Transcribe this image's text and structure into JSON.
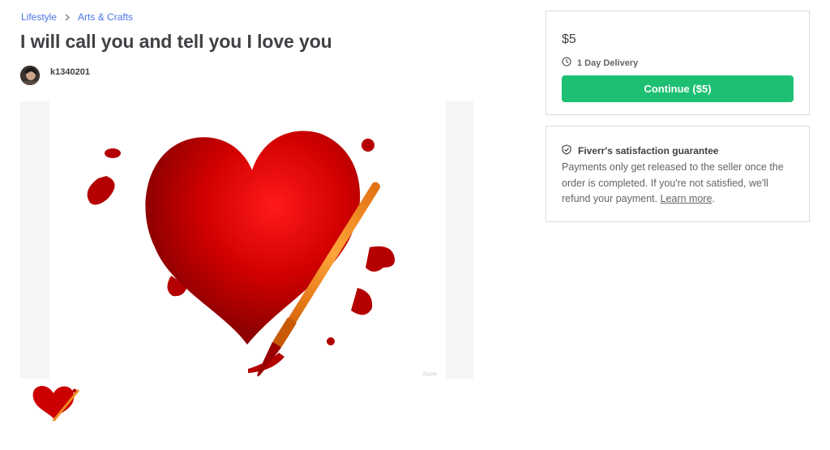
{
  "breadcrumb": {
    "items": [
      "Lifestyle",
      "Arts & Crafts"
    ]
  },
  "gig": {
    "title": "I will call you and tell you I love you",
    "seller": "k1340201",
    "watermark": "Zazzle"
  },
  "pricing": {
    "price": "$5",
    "delivery": "1 Day Delivery",
    "continue_label": "Continue ($5)"
  },
  "guarantee": {
    "title": "Fiverr's satisfaction guarantee",
    "body": "Payments only get released to the seller once the order is completed. If you're not satisfied, we'll refund your payment.",
    "link": "Learn more",
    "period": "."
  },
  "icons": {
    "chevron": "chevron-right-icon",
    "clock": "clock-icon",
    "shield": "shield-check-icon"
  },
  "colors": {
    "accent_green": "#1dbf73",
    "link_blue": "#4a73e8",
    "heart_red": "#c00000"
  }
}
